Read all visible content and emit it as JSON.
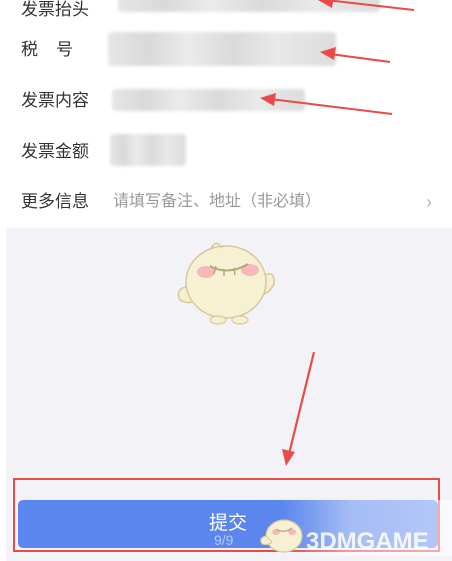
{
  "form": {
    "rows": [
      {
        "label": "发票抬头"
      },
      {
        "label": "税号"
      },
      {
        "label": "发票内容"
      },
      {
        "label": "发票金额"
      },
      {
        "label": "更多信息",
        "placeholder": "请填写备注、地址（非必填）"
      }
    ],
    "chevron": "›"
  },
  "submit": {
    "label": "提交"
  },
  "page_indicator": "9/9",
  "watermark": {
    "text": "3DMGAME"
  },
  "colors": {
    "annotation": "#e94a4a",
    "button": "#5b86ee",
    "background": "#f3f2f7"
  }
}
